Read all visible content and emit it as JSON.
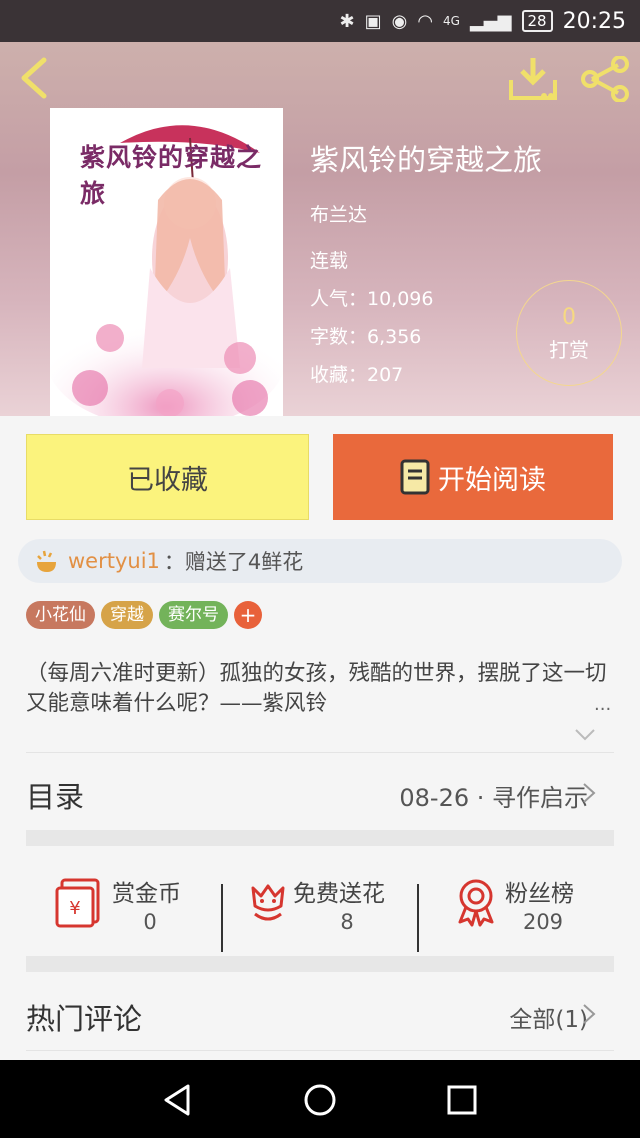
{
  "status_bar": {
    "signal": "4G",
    "battery": "28",
    "time": "20:25"
  },
  "book": {
    "cover_title": "紫风铃的穿越之旅",
    "title": "紫风铃的穿越之旅",
    "author": "布兰达",
    "status": "连载",
    "popularity": "人气：10,096",
    "word_count": "字数：6,356",
    "favorites": "收藏：207"
  },
  "reward": {
    "count": "0",
    "label": "打赏"
  },
  "actions": {
    "favorited_label": "已收藏",
    "read_label": "开始阅读"
  },
  "gift": {
    "user": "wertyui1",
    "text": "：赠送了4鲜花"
  },
  "tags": [
    {
      "label": "小花仙",
      "color": "#c7785f"
    },
    {
      "label": "穿越",
      "color": "#d6a348"
    },
    {
      "label": "赛尔号",
      "color": "#73b35a"
    }
  ],
  "tag_add": "+",
  "description": "（每周六准时更新）孤独的女孩，残酷的世界，摆脱了这一切又能意味着什么呢？——紫风铃",
  "description_more": "...",
  "catalog": {
    "title": "目录",
    "latest": "08-26 · 寻作启示"
  },
  "stats": {
    "coins": {
      "label": "赏金币",
      "value": "0"
    },
    "flowers": {
      "label": "免费送花",
      "value": "8"
    },
    "fans": {
      "label": "粉丝榜",
      "value": "209"
    }
  },
  "comments": {
    "title": "热门评论",
    "all": "全部(1)"
  },
  "colors": {
    "accent": "#e9693c",
    "favorited": "#fbf37d",
    "icon_red": "#d6362f",
    "gold": "#f6d981"
  }
}
